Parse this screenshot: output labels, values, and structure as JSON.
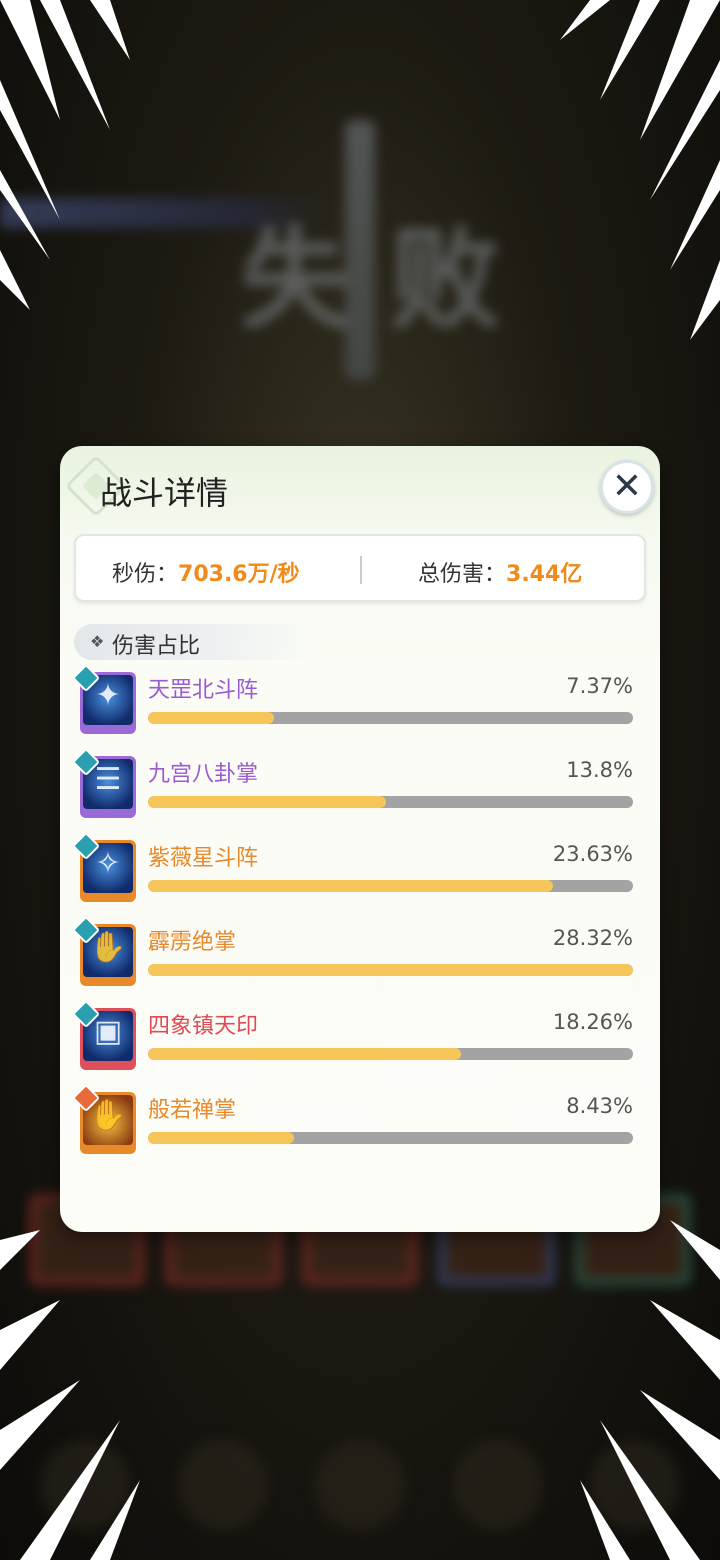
{
  "panel": {
    "title": "战斗详情",
    "close_label": "✕"
  },
  "stats": {
    "dps_label": "秒伤：",
    "dps_value": "703.6万/秒",
    "total_label": "总伤害：",
    "total_value": "3.44亿"
  },
  "section": {
    "label": "伤害占比"
  },
  "background": {
    "title_left": "失",
    "title_right": "败"
  },
  "skills": [
    {
      "name": "天罡北斗阵",
      "percent_label": "7.37%",
      "share": 0.26,
      "rarity": "purple",
      "name_color": "#9a5ad0",
      "icon": "constellation-icon"
    },
    {
      "name": "九宫八卦掌",
      "percent_label": "13.8%",
      "share": 0.49,
      "rarity": "purple",
      "name_color": "#9a5ad0",
      "icon": "palm-icon"
    },
    {
      "name": "紫薇星斗阵",
      "percent_label": "23.63%",
      "share": 0.835,
      "rarity": "orange",
      "name_color": "#e8892a",
      "icon": "star-array-icon"
    },
    {
      "name": "霹雳绝掌",
      "percent_label": "28.32%",
      "share": 1.0,
      "rarity": "orange",
      "name_color": "#e8892a",
      "icon": "lightning-palm-icon"
    },
    {
      "name": "四象镇天印",
      "percent_label": "18.26%",
      "share": 0.645,
      "rarity": "red",
      "name_color": "#e04a55",
      "icon": "seal-icon"
    },
    {
      "name": "般若禅掌",
      "percent_label": "8.43%",
      "share": 0.3,
      "rarity": "orange",
      "name_color": "#e8892a",
      "icon": "fire-palm-icon"
    }
  ]
}
